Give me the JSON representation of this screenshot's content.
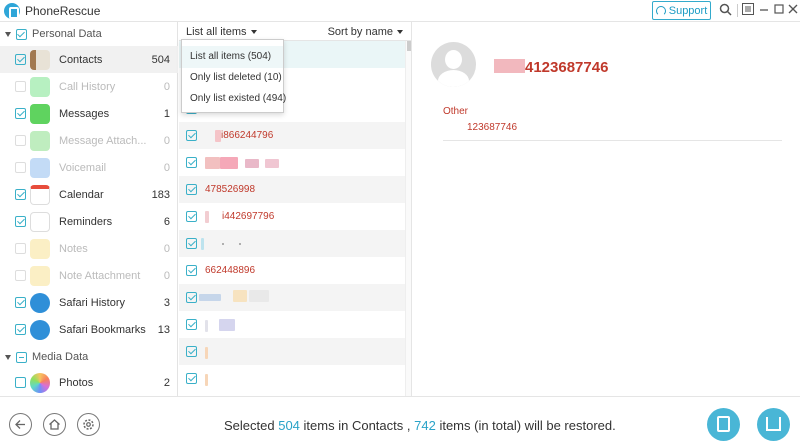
{
  "window": {
    "title": "PhoneRescue",
    "support_label": "Support",
    "icons": [
      "search-icon",
      "menu-icon",
      "minimize-icon",
      "maximize-icon",
      "close-icon"
    ]
  },
  "sidebar": {
    "groups": [
      {
        "label": "Personal Data",
        "state": "checked"
      },
      {
        "label": "Media Data",
        "state": "partial"
      }
    ],
    "items": [
      {
        "label": "Contacts",
        "count": "504",
        "checked": true,
        "enabled": true,
        "icon": "contacts-icon",
        "active": true
      },
      {
        "label": "Call History",
        "count": "0",
        "checked": false,
        "enabled": false,
        "icon": "phone-icon"
      },
      {
        "label": "Messages",
        "count": "1",
        "checked": true,
        "enabled": true,
        "icon": "messages-icon"
      },
      {
        "label": "Message Attach...",
        "count": "0",
        "checked": false,
        "enabled": false,
        "icon": "message-attachment-icon"
      },
      {
        "label": "Voicemail",
        "count": "0",
        "checked": false,
        "enabled": false,
        "icon": "voicemail-icon"
      },
      {
        "label": "Calendar",
        "count": "183",
        "checked": true,
        "enabled": true,
        "icon": "calendar-icon"
      },
      {
        "label": "Reminders",
        "count": "6",
        "checked": true,
        "enabled": true,
        "icon": "reminders-icon"
      },
      {
        "label": "Notes",
        "count": "0",
        "checked": false,
        "enabled": false,
        "icon": "notes-icon"
      },
      {
        "label": "Note Attachment",
        "count": "0",
        "checked": false,
        "enabled": false,
        "icon": "note-attachment-icon"
      },
      {
        "label": "Safari History",
        "count": "3",
        "checked": true,
        "enabled": true,
        "icon": "safari-history-icon"
      },
      {
        "label": "Safari Bookmarks",
        "count": "13",
        "checked": true,
        "enabled": true,
        "icon": "safari-bookmarks-icon"
      },
      {
        "label": "Photos",
        "count": "2",
        "checked": false,
        "enabled": true,
        "icon": "photos-icon"
      }
    ]
  },
  "list": {
    "filter_label": "List all items",
    "sort_label": "Sort by name",
    "dropdown_options": [
      "List all items (504)",
      "Only list deleted (10)",
      "Only list existed (494)"
    ],
    "rows": [
      "",
      "",
      "",
      "i866244796",
      "",
      "478526998",
      "i442697796",
      "",
      "662448896",
      "",
      "",
      "",
      ""
    ]
  },
  "detail": {
    "name": "4123687746",
    "field_label": "Other",
    "field_value": "123687746"
  },
  "footer": {
    "status_prefix": "Selected",
    "selected_count": "504",
    "status_middle": "items in Contacts ,",
    "total_count": "742",
    "status_suffix": "items (in total) will be restored."
  },
  "colors": {
    "accent": "#2aa3c8",
    "contact_red": "#c0392b"
  }
}
